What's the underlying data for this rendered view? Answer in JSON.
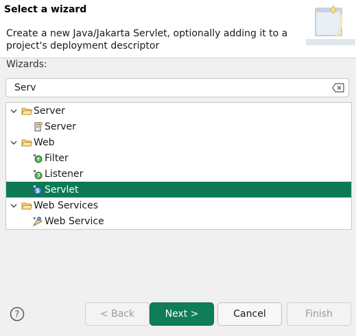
{
  "header": {
    "title": "Select a wizard",
    "description": "Create a new Java/Jakarta Servlet, optionally adding it to a project's deployment descriptor",
    "image_icon": "wizard-banner-icon"
  },
  "wizards_label": "Wizards:",
  "filter": {
    "value": "Serv",
    "clear_icon": "clear-text-icon"
  },
  "tree": {
    "items": [
      {
        "label": "Server",
        "type": "folder",
        "expanded": true,
        "icon": "folder-open-icon"
      },
      {
        "label": "Server",
        "type": "wizard",
        "icon": "server-icon"
      },
      {
        "label": "Web",
        "type": "folder",
        "expanded": true,
        "icon": "folder-open-icon"
      },
      {
        "label": "Filter",
        "type": "wizard",
        "icon": "filter-icon"
      },
      {
        "label": "Listener",
        "type": "wizard",
        "icon": "listener-icon"
      },
      {
        "label": "Servlet",
        "type": "wizard",
        "icon": "servlet-icon",
        "selected": true
      },
      {
        "label": "Web Services",
        "type": "folder",
        "expanded": true,
        "icon": "folder-open-icon"
      },
      {
        "label": "Web Service",
        "type": "wizard",
        "icon": "web-service-icon"
      }
    ]
  },
  "buttons": {
    "help_icon": "help-icon",
    "back": "< Back",
    "next": "Next >",
    "cancel": "Cancel",
    "finish": "Finish"
  },
  "colors": {
    "selection": "#0d7a55",
    "primary_button": "#0f7d58"
  }
}
